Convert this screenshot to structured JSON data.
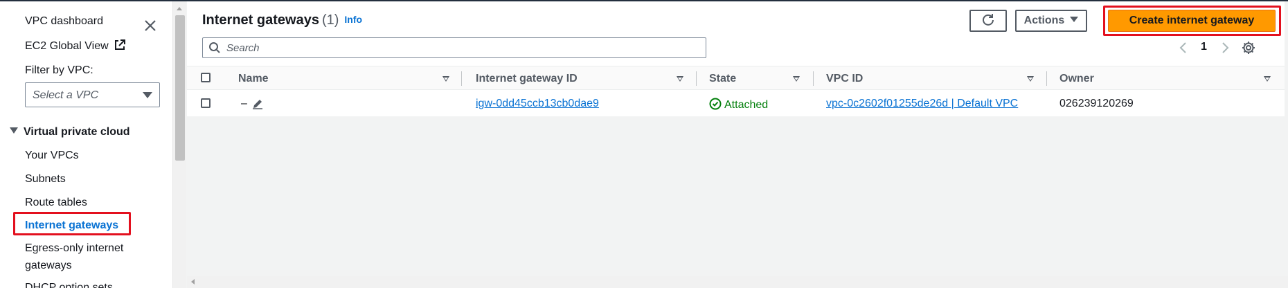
{
  "sidebar": {
    "vpc_dashboard": "VPC dashboard",
    "ec2_global_view": "EC2 Global View",
    "filter_label": "Filter by VPC:",
    "filter_placeholder": "Select a VPC",
    "section_title": "Virtual private cloud",
    "items": [
      {
        "label": "Your VPCs"
      },
      {
        "label": "Subnets"
      },
      {
        "label": "Route tables"
      },
      {
        "label": "Internet gateways"
      },
      {
        "label": "Egress-only internet"
      },
      {
        "label": "gateways"
      },
      {
        "label": "DHCP option sets"
      }
    ]
  },
  "header": {
    "title": "Internet gateways",
    "count": "(1)",
    "info": "Info",
    "actions_label": "Actions",
    "create_label": "Create internet gateway"
  },
  "search": {
    "placeholder": "Search"
  },
  "pagination": {
    "current_page": "1"
  },
  "table": {
    "columns": [
      "Name",
      "Internet gateway ID",
      "State",
      "VPC ID",
      "Owner"
    ],
    "rows": [
      {
        "name": "–",
        "igw_id": "igw-0dd45ccb13cb0dae9",
        "state": "Attached",
        "vpc_id": "vpc-0c2602f01255de26d | Default VPC",
        "owner": "026239120269"
      }
    ]
  },
  "colors": {
    "accent": "#0972d3",
    "primary_button": "#ff9900",
    "highlight": "#e3101e",
    "success": "#037f0c"
  },
  "icons": [
    "close-icon",
    "external-link-icon",
    "refresh-icon",
    "search-icon",
    "settings-gear-icon",
    "edit-pencil-icon",
    "status-success-icon"
  ]
}
